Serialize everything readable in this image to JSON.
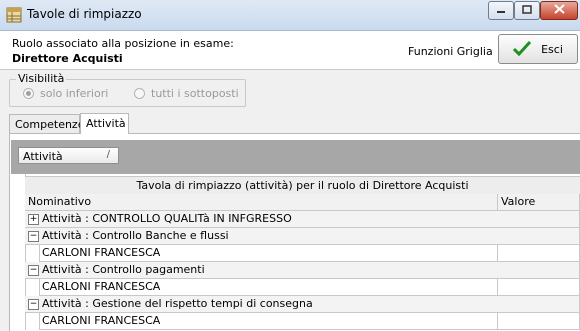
{
  "window": {
    "title": "Tavole di rimpiazzo",
    "icon": "grid-app-icon",
    "controls": [
      "minimize-icon",
      "maximize-icon",
      "close-icon"
    ]
  },
  "header": {
    "role_label": "Ruolo associato alla posizione in esame:",
    "role_value": "Direttore Acquisti",
    "grid_functions_label": "Funzioni Griglia",
    "exit_label": "Esci"
  },
  "visibility": {
    "title": "Visibilità",
    "options": [
      {
        "label": "solo inferiori",
        "selected": true
      },
      {
        "label": "tutti i sottoposti",
        "selected": false
      }
    ]
  },
  "tabs": [
    {
      "label": "Competenze",
      "active": false
    },
    {
      "label": "Attività",
      "active": true
    }
  ],
  "grid": {
    "group_by_chip": "Attività",
    "banner": "Tavola di rimpiazzo (attività) per il ruolo di Direttore Acquisti",
    "columns": [
      "Nominativo",
      "Valore"
    ],
    "groups": [
      {
        "label": "Attività : CONTROLLO QUALITà IN INFGRESSO",
        "expanded": false,
        "children": []
      },
      {
        "label": "Attività : Controllo Banche e flussi",
        "expanded": true,
        "children": [
          "CARLONI FRANCESCA"
        ]
      },
      {
        "label": "Attività : Controllo pagamenti",
        "expanded": true,
        "children": [
          "CARLONI FRANCESCA"
        ]
      },
      {
        "label": "Attività : Gestione del rispetto tempi di consegna",
        "expanded": true,
        "children": [
          "CARLONI FRANCESCA"
        ]
      }
    ]
  },
  "colors": {
    "titlebar": "#c9daee",
    "grid_background": "#a7a7a7",
    "check_green": "#1f8f1f"
  }
}
